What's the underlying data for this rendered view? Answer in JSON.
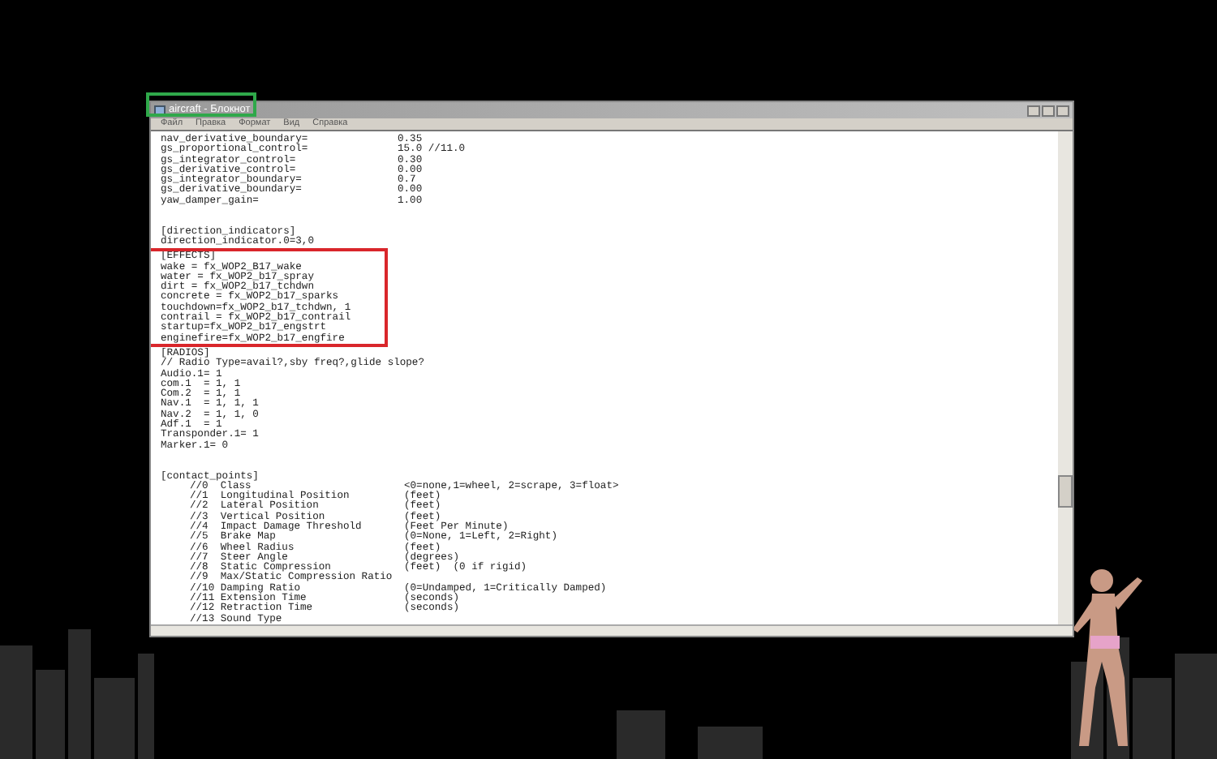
{
  "window": {
    "title": "aircraft - Блокнот",
    "title_highlighted": true
  },
  "menu": [
    "Файл",
    "Правка",
    "Формат",
    "Вид",
    "Справка"
  ],
  "sections": [
    {
      "highlighted": false,
      "lines": [
        {
          "kind": "pair",
          "key": "nav_derivative_boundary=",
          "value": "0.35"
        },
        {
          "kind": "pair",
          "key": "gs_proportional_control=",
          "value": "15.0 //11.0"
        },
        {
          "kind": "pair",
          "key": "gs_integrator_control=",
          "value": "0.30"
        },
        {
          "kind": "pair",
          "key": "gs_derivative_control=",
          "value": "0.00"
        },
        {
          "kind": "pair",
          "key": "gs_integrator_boundary=",
          "value": "0.7"
        },
        {
          "kind": "pair",
          "key": "gs_derivative_boundary=",
          "value": "0.00"
        },
        {
          "kind": "pair",
          "key": "yaw_damper_gain=",
          "value": "1.00"
        },
        {
          "kind": "blank"
        },
        {
          "kind": "blank"
        },
        {
          "kind": "plain",
          "text": "[direction_indicators]"
        },
        {
          "kind": "plain",
          "text": "direction_indicator.0=3,0"
        }
      ]
    },
    {
      "highlighted": true,
      "lines": [
        {
          "kind": "plain",
          "text": "[EFFECTS]"
        },
        {
          "kind": "plain",
          "text": "wake = fx_WOP2_B17_wake"
        },
        {
          "kind": "plain",
          "text": "water = fx_WOP2_b17_spray"
        },
        {
          "kind": "plain",
          "text": "dirt = fx_WOP2_b17_tchdwn"
        },
        {
          "kind": "plain",
          "text": "concrete = fx_WOP2_b17_sparks"
        },
        {
          "kind": "plain",
          "text": "touchdown=fx_WOP2_b17_tchdwn, 1"
        },
        {
          "kind": "plain",
          "text": "contrail = fx_WOP2_b17_contrail"
        },
        {
          "kind": "plain",
          "text": "startup=fx_WOP2_b17_engstrt"
        },
        {
          "kind": "plain",
          "text": "enginefire=fx_WOP2_b17_engfire"
        }
      ]
    },
    {
      "highlighted": false,
      "lines": [
        {
          "kind": "plain",
          "text": "[RADIOS]"
        },
        {
          "kind": "plain",
          "text": "// Radio Type=avail?,sby freq?,glide slope?"
        },
        {
          "kind": "plain",
          "text": "Audio.1= 1"
        },
        {
          "kind": "plain",
          "text": "com.1  = 1, 1"
        },
        {
          "kind": "plain",
          "text": "Com.2  = 1, 1"
        },
        {
          "kind": "plain",
          "text": "Nav.1  = 1, 1, 1"
        },
        {
          "kind": "plain",
          "text": "Nav.2  = 1, 1, 0"
        },
        {
          "kind": "plain",
          "text": "Adf.1  = 1"
        },
        {
          "kind": "plain",
          "text": "Transponder.1= 1"
        },
        {
          "kind": "plain",
          "text": "Marker.1= 0"
        },
        {
          "kind": "blank"
        },
        {
          "kind": "blank"
        },
        {
          "kind": "plain",
          "text": "[contact_points]"
        },
        {
          "kind": "comment",
          "text": "//0  Class",
          "note": "<0=none,1=wheel, 2=scrape, 3=float>"
        },
        {
          "kind": "comment",
          "text": "//1  Longitudinal Position",
          "note": "(feet)"
        },
        {
          "kind": "comment",
          "text": "//2  Lateral Position",
          "note": "(feet)"
        },
        {
          "kind": "comment",
          "text": "//3  Vertical Position",
          "note": "(feet)"
        },
        {
          "kind": "comment",
          "text": "//4  Impact Damage Threshold",
          "note": "(Feet Per Minute)"
        },
        {
          "kind": "comment",
          "text": "//5  Brake Map",
          "note": "(0=None, 1=Left, 2=Right)"
        },
        {
          "kind": "comment",
          "text": "//6  Wheel Radius",
          "note": "(feet)"
        },
        {
          "kind": "comment",
          "text": "//7  Steer Angle",
          "note": "(degrees)"
        },
        {
          "kind": "comment",
          "text": "//8  Static Compression",
          "note": "(feet)  (0 if rigid)"
        },
        {
          "kind": "comment",
          "text": "//9  Max/Static Compression Ratio"
        },
        {
          "kind": "comment",
          "text": "//10 Damping Ratio",
          "note": "(0=Undamped, 1=Critically Damped)"
        },
        {
          "kind": "comment",
          "text": "//11 Extension Time",
          "note": "(seconds)"
        },
        {
          "kind": "comment",
          "text": "//12 Retraction Time",
          "note": "(seconds)"
        },
        {
          "kind": "comment",
          "text": "//13 Sound Type"
        }
      ]
    }
  ]
}
